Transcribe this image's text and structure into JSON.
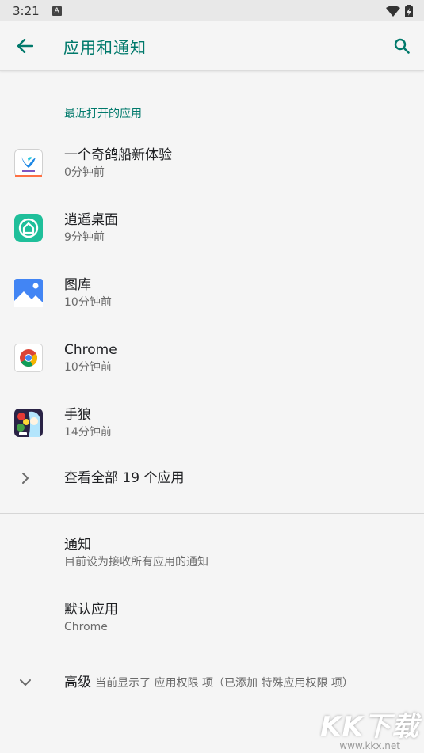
{
  "status_bar": {
    "time": "3:21",
    "notification_badge": "A"
  },
  "app_bar": {
    "title": "应用和通知"
  },
  "recent": {
    "header": "最近打开的应用",
    "apps": [
      {
        "name": "一个奇鸽船新体验",
        "time": "0分钟前",
        "icon": "pigeon-app-icon"
      },
      {
        "name": "逍遥桌面",
        "time": "9分钟前",
        "icon": "home-launcher-icon"
      },
      {
        "name": "图库",
        "time": "10分钟前",
        "icon": "gallery-icon"
      },
      {
        "name": "Chrome",
        "time": "10分钟前",
        "icon": "chrome-icon"
      },
      {
        "name": "手狼",
        "time": "14分钟前",
        "icon": "game-app-icon"
      }
    ],
    "see_all": "查看全部 19 个应用"
  },
  "settings": {
    "notifications": {
      "title": "通知",
      "summary": "目前设为接收所有应用的通知"
    },
    "default_apps": {
      "title": "默认应用",
      "summary": "Chrome"
    },
    "advanced": {
      "title": "高级",
      "summary": "当前显示了 应用权限 项（已添加 特殊应用权限 项）"
    }
  },
  "watermark": {
    "logo": "KK下载",
    "url": "www.kkx.net"
  },
  "colors": {
    "accent": "#00796b",
    "background": "#f5f5f5",
    "status_bar": "#e8e8e8"
  }
}
